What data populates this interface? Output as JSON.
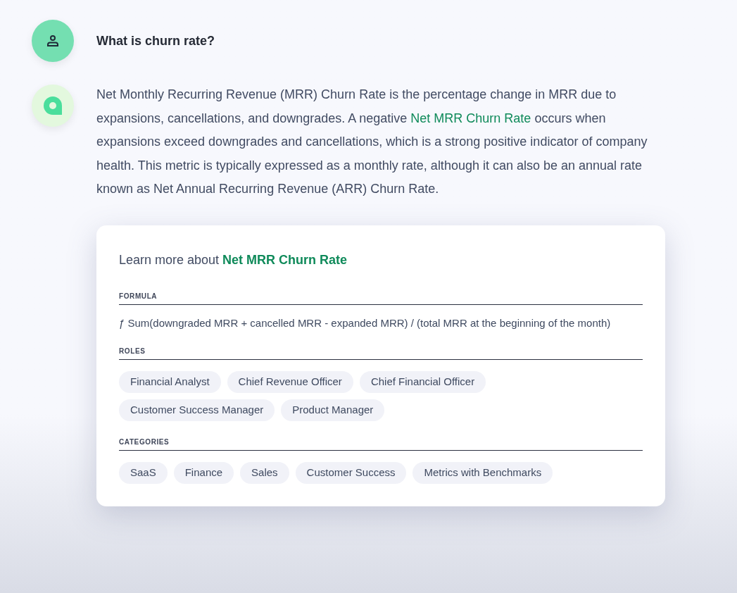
{
  "question": {
    "text": "What is churn rate?"
  },
  "answer": {
    "before": "Net Monthly Recurring Revenue (MRR) Churn Rate is the percentage change in MRR due to expansions, cancellations, and downgrades. A negative ",
    "link": "Net MRR Churn Rate",
    "after": " occurs when expansions exceed downgrades and cancellations, which is a strong positive indicator of company health. This metric is typically expressed as a monthly rate, although it can also be an annual rate known as Net Annual Recurring Revenue (ARR) Churn Rate."
  },
  "card": {
    "lead": "Learn more about ",
    "link": "Net MRR Churn Rate",
    "sections": [
      {
        "kind": "text",
        "label": "FORMULA",
        "text": "ƒ Sum(downgraded MRR + cancelled MRR - expanded MRR) / (total MRR at the beginning of the month)"
      },
      {
        "kind": "tags",
        "label": "ROLES",
        "tags": [
          "Financial Analyst",
          "Chief Revenue Officer",
          "Chief Financial Officer",
          "Customer Success Manager",
          "Product Manager"
        ]
      },
      {
        "kind": "tags",
        "label": "CATEGORIES",
        "tags": [
          "SaaS",
          "Finance",
          "Sales",
          "Customer Success",
          "Metrics with Benchmarks"
        ]
      }
    ]
  }
}
